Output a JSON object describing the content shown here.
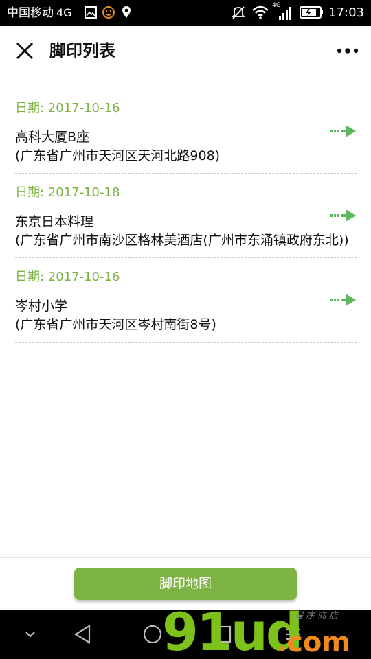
{
  "status_bar": {
    "carrier": "中国移动",
    "network": "4G",
    "data_badge": "4G",
    "time": "17:03"
  },
  "header": {
    "title": "脚印列表",
    "close_icon": "close-icon",
    "more_icon": "more-dots-icon"
  },
  "entries": [
    {
      "date": "日期: 2017-10-16",
      "name": "高科大厦B座",
      "address": "(广东省广州市天河区天河北路908)"
    },
    {
      "date": "日期: 2017-10-18",
      "name": "东京日本料理",
      "address": "(广东省广州市南沙区格林美酒店(广州市东涌镇政府东北))"
    },
    {
      "date": "日期: 2017-10-16",
      "name": "岑村小学",
      "address": "(广东省广州市天河区岑村南街8号)"
    }
  ],
  "action": {
    "map_button_label": "脚印地图"
  },
  "watermark": {
    "big": "91ud",
    "dotcom": ".com",
    "small": "程序商店"
  },
  "colors": {
    "accent_green": "#7cb342",
    "arrow_green": "#5cb85c",
    "status_bar_bg": "#000000",
    "divider": "#c8c8c8"
  }
}
